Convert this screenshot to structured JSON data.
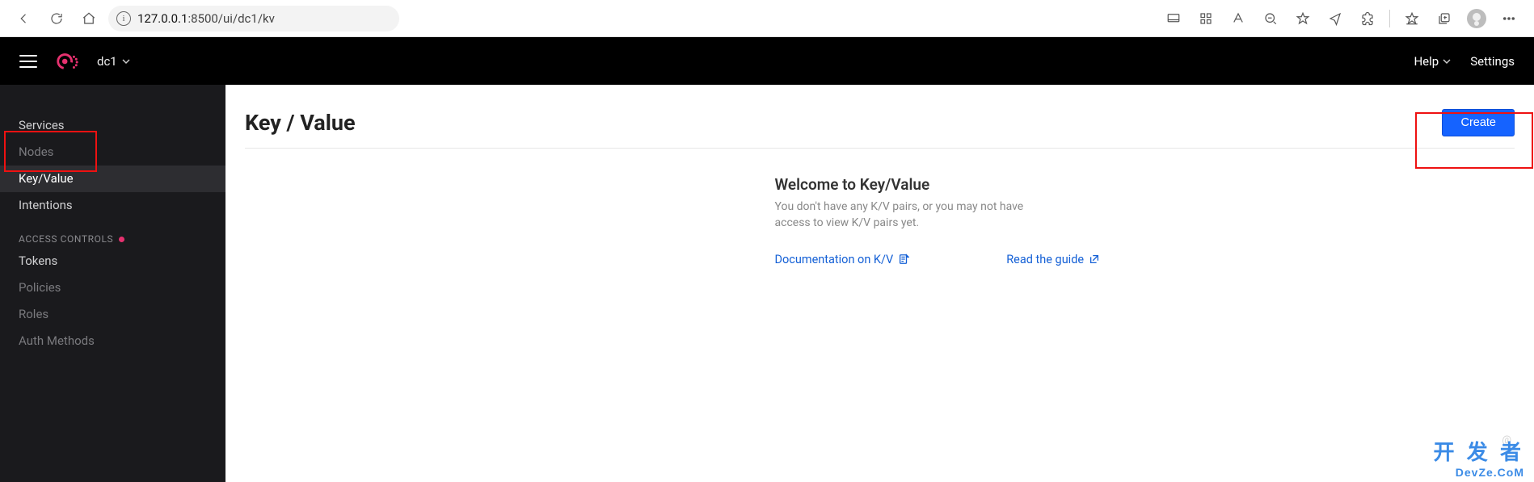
{
  "browser": {
    "url_prefix": "127.0.0.1",
    "url_port_path": ":8500/ui/dc1/kv"
  },
  "header": {
    "datacenter": "dc1",
    "help": "Help",
    "settings": "Settings"
  },
  "sidebar": {
    "items": [
      {
        "label": "Services",
        "dim": false
      },
      {
        "label": "Nodes",
        "dim": true
      },
      {
        "label": "Key/Value",
        "active": true
      },
      {
        "label": "Intentions",
        "dim": false
      }
    ],
    "section_label": "ACCESS CONTROLS",
    "ac_items": [
      {
        "label": "Tokens",
        "dim": false
      },
      {
        "label": "Policies",
        "dim": true
      },
      {
        "label": "Roles",
        "dim": true
      },
      {
        "label": "Auth Methods",
        "dim": true
      }
    ]
  },
  "main": {
    "title": "Key / Value",
    "create_label": "Create",
    "empty_title": "Welcome to Key/Value",
    "empty_sub": "You don't have any K/V pairs, or you may not have access to view K/V pairs yet.",
    "doc_link": "Documentation on K/V",
    "guide_link": "Read the guide"
  },
  "watermark": {
    "handle": "@",
    "brand_line1": "开 发 者",
    "brand_line2": "DevZe.CoM"
  }
}
